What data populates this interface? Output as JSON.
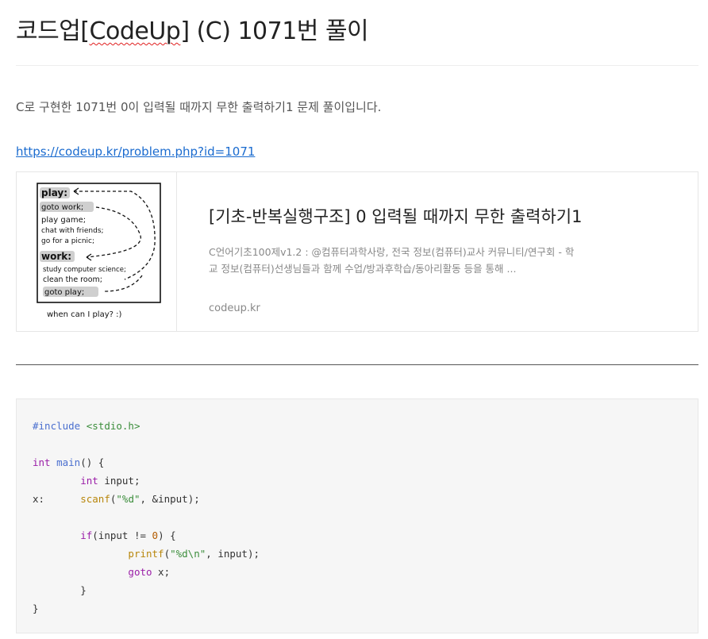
{
  "post": {
    "title_prefix": "코드업[",
    "title_brand": "CodeUp",
    "title_suffix": "] (C) 1071번 풀이",
    "intro": "C로 구현한 1071번 0이 입력될 때까지 무한 출력하기1 문제 풀이입니다.",
    "link_text": "https://codeup.kr/problem.php?id=1071"
  },
  "og_card": {
    "title": "[기초-반복실행구조] 0 입력될 때까지 무한 출력하기1",
    "description": "C언어기초100제v1.2 : @컴퓨터과학사랑, 전국 정보(컴퓨터)교사 커뮤니티/연구회 - 학교 정보(컴퓨터)선생님들과 함께 수업/방과후학습/동아리활동 등을 통해 ...",
    "site": "codeup.kr",
    "thumb": {
      "play": "play:",
      "goto_work": "goto work;",
      "play_game": "play game;",
      "chat": "chat with friends;",
      "picnic": "go for a picnic;",
      "work": "work:",
      "study": "study computer science;",
      "clean": "clean the room;",
      "goto_play": "goto play;",
      "caption": "when can I play? :)"
    }
  },
  "code": {
    "line1_pre": "#include",
    "line1_inc": "<stdio.h>",
    "line3_type": "int",
    "line3_fn": "main",
    "line3_rest": "() {",
    "line4_indent": "        ",
    "line4_type": "int",
    "line4_rest": " input;",
    "line5_label": "x:      ",
    "line5_call": "scanf",
    "line5_open": "(",
    "line5_str": "\"%d\"",
    "line5_rest": ", &input);",
    "line7_indent": "        ",
    "line7_kw": "if",
    "line7_mid": "(input != ",
    "line7_num": "0",
    "line7_rest": ") {",
    "line8_indent": "                ",
    "line8_call": "printf",
    "line8_open": "(",
    "line8_str": "\"%d\\n\"",
    "line8_rest": ", input);",
    "line9_indent": "                ",
    "line9_kw": "goto",
    "line9_rest": " x;",
    "line10": "        }",
    "line11": "}"
  }
}
